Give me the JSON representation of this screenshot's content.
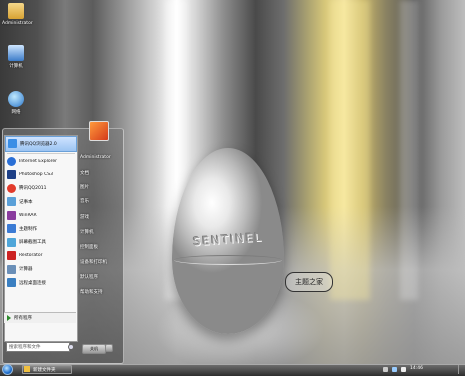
{
  "desktop": {
    "icons": [
      {
        "label": "Administrator"
      },
      {
        "label": "计算机"
      },
      {
        "label": "网络"
      }
    ],
    "wallpaper": {
      "egg_text": "SENTINEL",
      "brand_text": "主题之家"
    }
  },
  "start_menu": {
    "programs": [
      {
        "label": "腾讯QQ浏览器2.0",
        "color": "#3a8ee6"
      },
      {
        "label": "Internet Explorer",
        "color": "#2a6fd6"
      },
      {
        "label": "Photoshop CS3",
        "color": "#1d3f86"
      },
      {
        "label": "腾讯QQ2011",
        "color": "#e23b2b"
      },
      {
        "label": "记事本",
        "color": "#5aa0d8"
      },
      {
        "label": "WinRAR",
        "color": "#8a3c9e"
      },
      {
        "label": "主题制作",
        "color": "#3b7bd4"
      },
      {
        "label": "屏幕截图工具",
        "color": "#4fa6d9"
      },
      {
        "label": "Restorator",
        "color": "#cc2222"
      },
      {
        "label": "计算器",
        "color": "#6a8fb8"
      },
      {
        "label": "远程桌面连接",
        "color": "#3a7fc1"
      }
    ],
    "all_programs_label": "所有程序",
    "search_placeholder": "搜索程序和文件",
    "user_name": "Administrator",
    "right_items": [
      "文档",
      "图片",
      "音乐",
      "游戏",
      "计算机",
      "控制面板",
      "设备和打印机",
      "默认程序",
      "帮助和支持"
    ],
    "shutdown_label": "关机"
  },
  "taskbar": {
    "task_label": "新建文件夹",
    "clock": "14:46"
  }
}
